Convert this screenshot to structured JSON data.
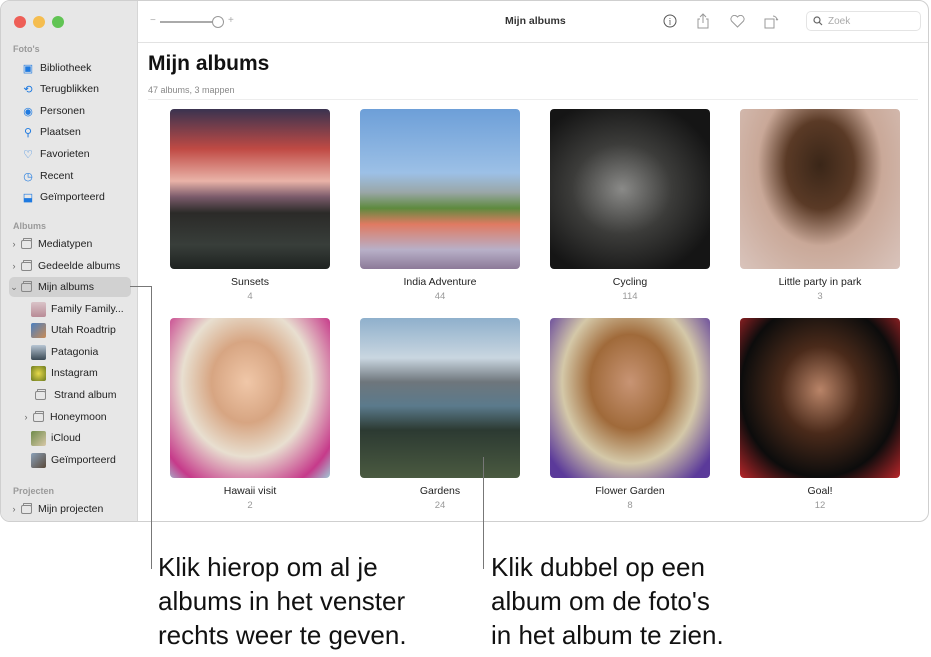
{
  "sidebar": {
    "sections": {
      "photos": "Foto's",
      "albums": "Albums",
      "projects": "Projecten"
    },
    "photos_items": [
      {
        "label": "Bibliotheek",
        "icon": "library-icon"
      },
      {
        "label": "Terugblikken",
        "icon": "memories-icon"
      },
      {
        "label": "Personen",
        "icon": "people-icon"
      },
      {
        "label": "Plaatsen",
        "icon": "places-icon"
      },
      {
        "label": "Favorieten",
        "icon": "heart-icon"
      },
      {
        "label": "Recent",
        "icon": "clock-icon"
      },
      {
        "label": "Geïmporteerd",
        "icon": "import-icon"
      }
    ],
    "album_items": [
      {
        "label": "Mediatypen"
      },
      {
        "label": "Gedeelde albums"
      },
      {
        "label": "Mijn albums"
      }
    ],
    "my_albums": [
      {
        "label": "Family Family..."
      },
      {
        "label": "Utah Roadtrip"
      },
      {
        "label": "Patagonia"
      },
      {
        "label": "Instagram"
      },
      {
        "label": "Strand album"
      },
      {
        "label": "Honeymoon"
      },
      {
        "label": "iCloud"
      },
      {
        "label": "Geïmporteerd"
      }
    ],
    "project_items": [
      {
        "label": "Mijn projecten"
      }
    ]
  },
  "toolbar": {
    "title": "Mijn albums",
    "zoom_minus": "−",
    "zoom_plus": "+",
    "zoom_level": 0.9,
    "search_placeholder": "Zoek"
  },
  "main": {
    "title": "Mijn albums",
    "subtitle": "47 albums, 3 mappen",
    "albums": [
      {
        "name": "Sunsets",
        "count": "4"
      },
      {
        "name": "India Adventure",
        "count": "44"
      },
      {
        "name": "Cycling",
        "count": "114"
      },
      {
        "name": "Little party in park",
        "count": "3"
      },
      {
        "name": "Hawaii visit",
        "count": "2"
      },
      {
        "name": "Gardens",
        "count": "24"
      },
      {
        "name": "Flower Garden",
        "count": "8"
      },
      {
        "name": "Goal!",
        "count": "12"
      }
    ]
  },
  "callouts": {
    "left": [
      "Klik hierop om al je",
      "albums in het venster",
      "rechts weer te geven."
    ],
    "right": [
      "Klik dubbel op een",
      "album om de foto's",
      "in het album te zien."
    ]
  },
  "colors": {
    "accent": "#1f7ae0",
    "sidebar_bg": "#e7e7e7",
    "close": "#ee5f57",
    "minimize": "#f5bd4f",
    "zoom": "#61c454"
  }
}
